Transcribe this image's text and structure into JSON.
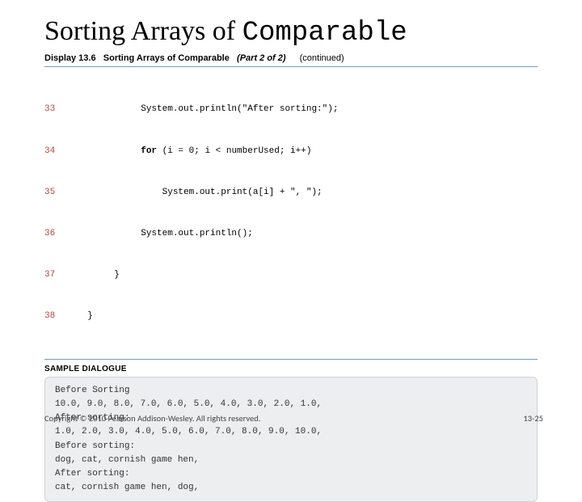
{
  "title_plain": "Sorting Arrays of ",
  "title_mono": "Comparable",
  "display": {
    "num": "Display 13.6",
    "title": "Sorting Arrays of Comparable",
    "part": "(Part 2 of 2)",
    "cont": "(continued)"
  },
  "code": [
    {
      "ln": "33",
      "indent": "            ",
      "text": "System.out.println(\"After sorting:\");"
    },
    {
      "ln": "34",
      "indent": "            ",
      "kw": "for",
      "text": " (i = 0; i < numberUsed; i++)"
    },
    {
      "ln": "35",
      "indent": "                ",
      "text": "System.out.print(a[i] + \", \");"
    },
    {
      "ln": "36",
      "indent": "            ",
      "text": "System.out.println();"
    },
    {
      "ln": "37",
      "indent": "       ",
      "text": "}"
    },
    {
      "ln": "38",
      "indent": "  ",
      "text": "}"
    }
  ],
  "sample_label": "Sample Dialogue",
  "sample_lines": [
    "Before Sorting",
    "10.0, 9.0, 8.0, 7.0, 6.0, 5.0, 4.0, 3.0, 2.0, 1.0,",
    "After sorting:",
    "1.0, 2.0, 3.0, 4.0, 5.0, 6.0, 7.0, 8.0, 9.0, 10.0,",
    "Before sorting:",
    "dog, cat, cornish game hen,",
    "After sorting:",
    "cat, cornish game hen, dog,"
  ],
  "footer": {
    "copyright": "Copyright © 2010 Pearson Addison-Wesley. All rights reserved.",
    "pagenum": "13-25"
  }
}
